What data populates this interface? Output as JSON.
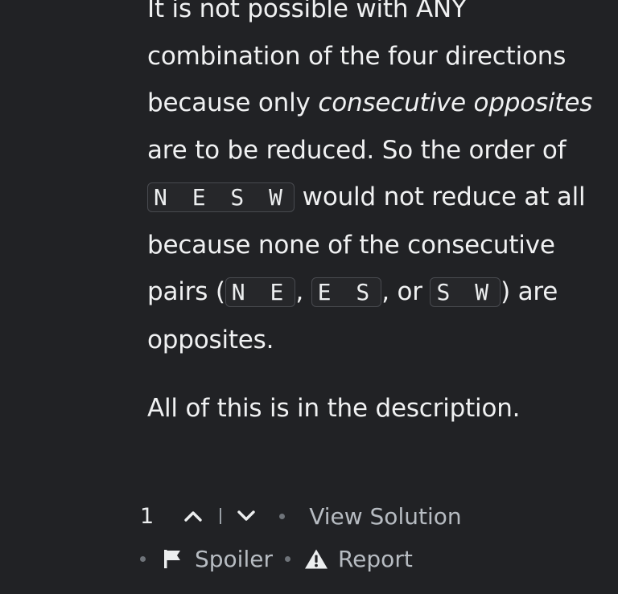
{
  "comment": {
    "paragraph1": {
      "line1_text": "It is not possible with ANY combination of the four directions because only ",
      "emphasis": "consecutive opposites",
      "after_emphasis": " are to be reduced. So the order of ",
      "code_nesw": "N E S W",
      "after_nesw": " would not reduce at all because none of the consecutive pairs (",
      "code_ne": "N E",
      "sep1": ", ",
      "code_es": "E S",
      "sep2": ", or ",
      "code_sw": "S W",
      "after_pairs": ") are opposites."
    },
    "paragraph2": "All of this is in the description."
  },
  "actions": {
    "vote_count": "1",
    "view_solution_label": "View Solution",
    "spoiler_label": "Spoiler",
    "report_label": "Report"
  },
  "icons": {
    "upvote": "chevron-up-icon",
    "downvote": "chevron-down-icon",
    "spoiler": "flag-icon",
    "report": "warning-icon"
  },
  "colors": {
    "background": "#212225",
    "text": "#f0f1f2",
    "muted": "#b7bcc2",
    "code_border": "#484a4f"
  }
}
